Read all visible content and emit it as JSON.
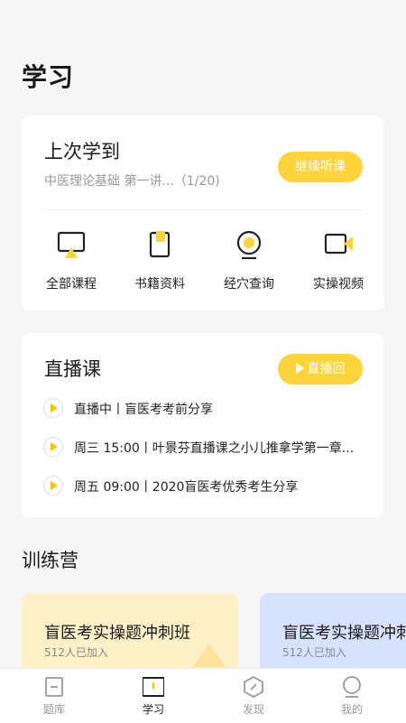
{
  "page": {
    "title": "学习"
  },
  "last_study": {
    "title": "上次学到",
    "subtitle": "中医理论基础 第一讲...（1/20)",
    "continue_label": "继续听课"
  },
  "shortcuts": [
    {
      "label": "全部课程",
      "icon": "monitor-icon"
    },
    {
      "label": "书籍资料",
      "icon": "book-icon"
    },
    {
      "label": "经穴查询",
      "icon": "acupoint-icon"
    },
    {
      "label": "实操视频",
      "icon": "video-camera-icon"
    }
  ],
  "live": {
    "title": "直播课",
    "replay_label": "直播回听",
    "items": [
      {
        "text": "直播中丨盲医考考前分享"
      },
      {
        "text": "周三 15:00丨叶景芬直播课之小儿推拿学第一章..."
      },
      {
        "text": "周五 09:00丨2020盲医考优秀考生分享"
      }
    ]
  },
  "camp": {
    "title": "训练营",
    "cards": [
      {
        "title": "盲医考实操题冲刺班",
        "subtitle": "512人已加入"
      },
      {
        "title": "盲医考实操题冲刺班",
        "subtitle": "512人已加入"
      }
    ]
  },
  "tabs": [
    {
      "label": "题库",
      "icon": "question-bank-icon",
      "active": false
    },
    {
      "label": "学习",
      "icon": "study-icon",
      "active": true
    },
    {
      "label": "发现",
      "icon": "discover-icon",
      "active": false
    },
    {
      "label": "我的",
      "icon": "profile-icon",
      "active": false
    }
  ],
  "colors": {
    "accent": "#ffd43b",
    "camp_yellow": "#fff0c8",
    "camp_blue": "#d6e2ff"
  }
}
